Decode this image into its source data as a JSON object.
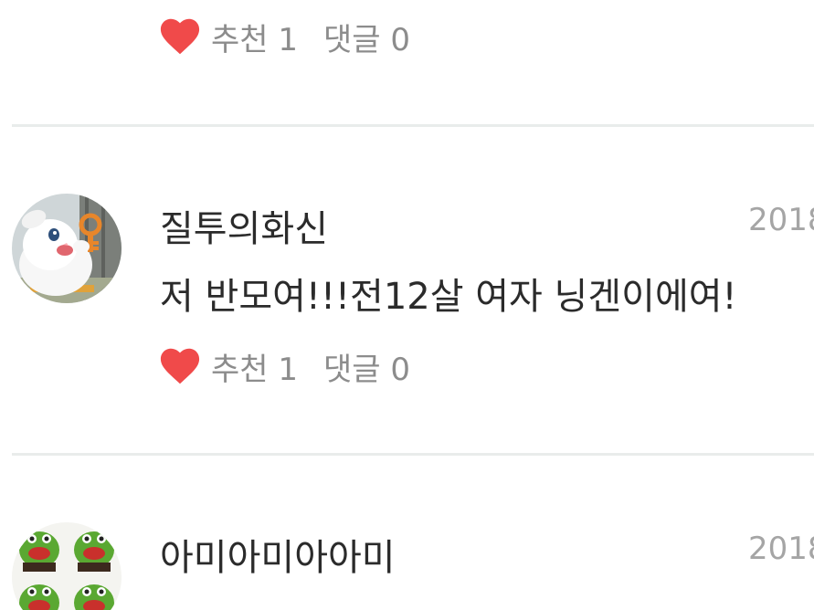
{
  "comments": [
    {
      "likes_label": "추천",
      "likes_count": "1",
      "replies_label": "댓글",
      "replies_count": "0"
    },
    {
      "username": "질투의화신",
      "date": "2018",
      "text": "저 반모여!!!전12살 여자 닝겐이에여!",
      "likes_label": "추천",
      "likes_count": "1",
      "replies_label": "댓글",
      "replies_count": "0",
      "avatar_icon": "white-rabbit-with-key-avatar"
    },
    {
      "username": "아미아미아아미",
      "date": "2018",
      "avatar_icon": "green-frog-grid-avatar"
    }
  ],
  "colors": {
    "heart": "#f04a4a",
    "meta_text": "#8c8c8c",
    "date_text": "#a5a5a5",
    "body_text": "#2b2b2b",
    "divider": "#e9eceb"
  }
}
